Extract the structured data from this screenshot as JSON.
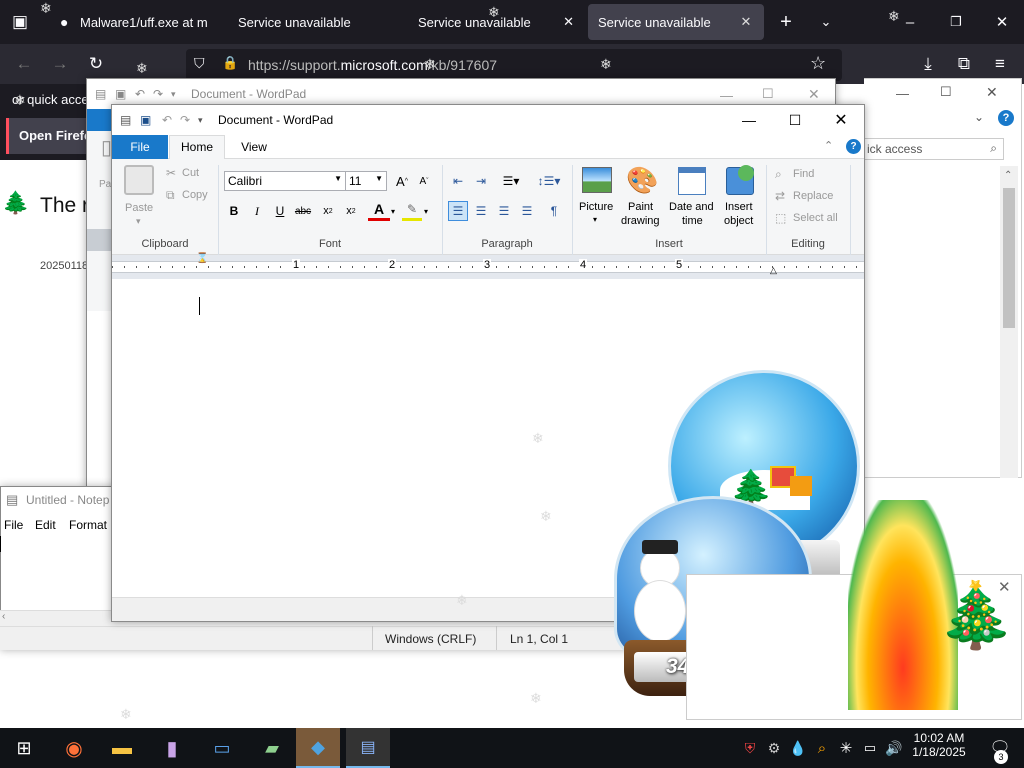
{
  "firefox": {
    "tabs": [
      {
        "label": "Malware1/uff.exe at m"
      },
      {
        "label": "Service unavailable"
      },
      {
        "label": "Service unavailable"
      },
      {
        "label": "Service unavailable"
      }
    ],
    "url_prefix": "https://support.",
    "url_domain": "microsoft.com",
    "url_path": "/kb/917607",
    "bookmark_hint": "or quick access",
    "open_firefox_label": "Open Firefox",
    "page_heading": "The r",
    "page_date": "20250118"
  },
  "wordpad_back": {
    "title": "Document - WordPad",
    "search_placeholder": "ick access"
  },
  "wordpad": {
    "title": "Document - WordPad",
    "tabs": {
      "file": "File",
      "home": "Home",
      "view": "View"
    },
    "clipboard": {
      "paste": "Paste",
      "cut": "Cut",
      "copy": "Copy",
      "label": "Clipboard"
    },
    "font": {
      "family": "Calibri",
      "size": "11",
      "label": "Font"
    },
    "paragraph": {
      "label": "Paragraph"
    },
    "insert": {
      "picture": "Picture",
      "paint_line1": "Paint",
      "paint_line2": "drawing",
      "datetime_line1": "Date and",
      "datetime_line2": "time",
      "object_line1": "Insert",
      "object_line2": "object",
      "label": "Insert"
    },
    "editing": {
      "find": "Find",
      "replace": "Replace",
      "select_all": "Select all",
      "label": "Editing"
    },
    "ruler_numbers": [
      "1",
      "2",
      "3",
      "4",
      "5"
    ]
  },
  "notepad": {
    "title": "Untitled - Notep",
    "menu": {
      "file": "File",
      "edit": "Edit",
      "format": "Format"
    },
    "status_encoding": "Windows (CRLF)",
    "status_position": "Ln 1, Col 1"
  },
  "widget": {
    "days_text": "340 days"
  },
  "taskbar": {
    "time": "10:02 AM",
    "date": "1/18/2025",
    "notification_count": "3"
  }
}
